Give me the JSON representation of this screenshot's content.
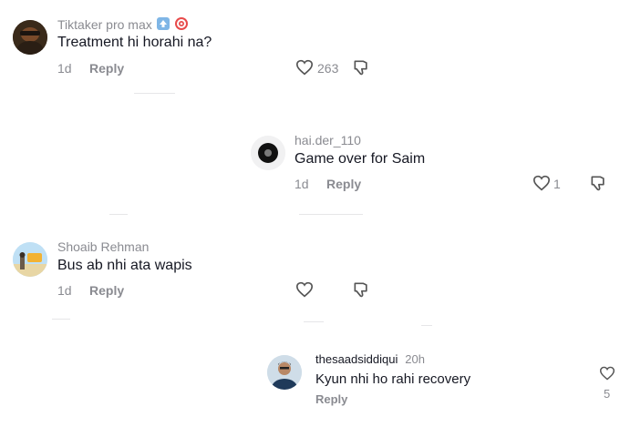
{
  "comments": [
    {
      "username": "Tiktaker pro max",
      "text": "Treatment hi horahi na?",
      "time": "1d",
      "reply_label": "Reply",
      "likes": "263"
    },
    {
      "username": "hai.der_110",
      "text": "Game over for Saim",
      "time": "1d",
      "reply_label": "Reply",
      "likes": "1"
    },
    {
      "username": "Shoaib Rehman",
      "text": "Bus ab nhi ata wapis",
      "time": "1d",
      "reply_label": "Reply",
      "likes": ""
    },
    {
      "username": "thesaadsiddiqui",
      "time": "20h",
      "text": "Kyun nhi ho rahi recovery",
      "reply_label": "Reply",
      "likes": "5"
    }
  ],
  "icons": {
    "like": "heart-outline-icon",
    "dislike": "thumbs-down-icon",
    "badges": [
      "up-arrow-emoji-icon",
      "target-emoji-icon"
    ]
  },
  "colors": {
    "text": "#161823",
    "secondary": "#8a8b91",
    "icon": "#555555"
  }
}
